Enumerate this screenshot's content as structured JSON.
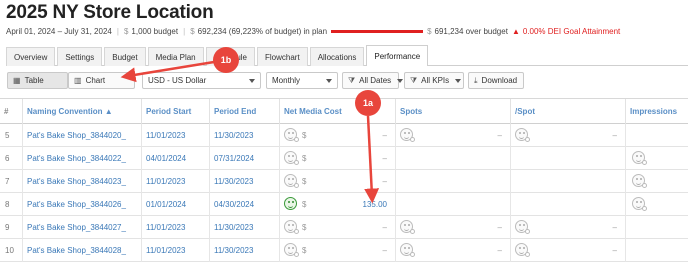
{
  "page": {
    "title": "2025 NY Store Location",
    "date_range": "April 01, 2024 – July 31, 2024",
    "currency_symbol": "$",
    "budget": "1,000 budget",
    "in_plan": "692,234 (69,223% of budget) in plan",
    "over_budget": "691,234 over budget",
    "goal_alert": "0.00% DEI Goal Attainment",
    "colors": {
      "alert": "#e02020",
      "link": "#3a78b7",
      "callout": "#e8453c",
      "header_text": "#5a8fc6"
    }
  },
  "tabs": [
    {
      "label": "Overview",
      "active": false
    },
    {
      "label": "Settings",
      "active": false
    },
    {
      "label": "Budget",
      "active": false
    },
    {
      "label": "Media Plan",
      "active": false
    },
    {
      "label": "Schedule",
      "active": false
    },
    {
      "label": "Flowchart",
      "active": false
    },
    {
      "label": "Allocations",
      "active": false
    },
    {
      "label": "Performance",
      "active": true
    }
  ],
  "toolbar": {
    "table_label": "Table",
    "chart_label": "Chart",
    "currency": "USD - US Dollar",
    "period": "Monthly",
    "dates_filter": "All Dates",
    "kpis_filter": "All KPIs",
    "download_label": "Download"
  },
  "table": {
    "columns": [
      "#",
      "Naming Convention ▲",
      "Period Start",
      "Period End",
      "Net Media Cost",
      "Spots",
      "/Spot",
      "Impressions"
    ],
    "rows": [
      {
        "num": "5",
        "name": "Pat's Bake Shop_3844020_",
        "start": "11/01/2023",
        "end": "11/30/2023",
        "cost": "–",
        "spots": "–",
        "per_spot": "–",
        "impressions": ""
      },
      {
        "num": "6",
        "name": "Pat's Bake Shop_3844022_",
        "start": "04/01/2024",
        "end": "07/31/2024",
        "cost": "–",
        "spots": "",
        "per_spot": "",
        "impressions": ""
      },
      {
        "num": "7",
        "name": "Pat's Bake Shop_3844023_",
        "start": "11/01/2023",
        "end": "11/30/2023",
        "cost": "–",
        "spots": "",
        "per_spot": "",
        "impressions": ""
      },
      {
        "num": "8",
        "name": "Pat's Bake Shop_3844026_",
        "start": "01/01/2024",
        "end": "04/30/2024",
        "cost": "135.00",
        "spots": "",
        "per_spot": "",
        "impressions": ""
      },
      {
        "num": "9",
        "name": "Pat's Bake Shop_3844027_",
        "start": "11/01/2023",
        "end": "11/30/2023",
        "cost": "–",
        "spots": "–",
        "per_spot": "–",
        "impressions": ""
      },
      {
        "num": "10",
        "name": "Pat's Bake Shop_3844028_",
        "start": "11/01/2023",
        "end": "11/30/2023",
        "cost": "–",
        "spots": "–",
        "per_spot": "–",
        "impressions": ""
      }
    ]
  },
  "callouts": {
    "a": "1a",
    "b": "1b"
  }
}
